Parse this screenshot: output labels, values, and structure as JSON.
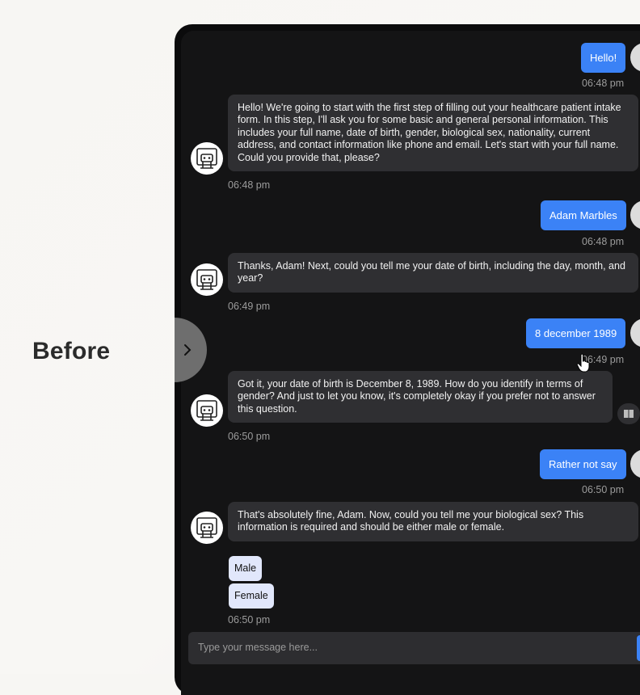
{
  "label": "Before",
  "messages": [
    {
      "role": "user",
      "text": "Hello!",
      "time": "06:48 pm"
    },
    {
      "role": "bot",
      "text": "Hello! We're going to start with the first step of filling out your healthcare patient intake form. In this step, I'll ask you for some basic and general personal information. This includes your full name, date of birth, gender, biological sex, nationality, current address, and contact information like phone and email. Let's start with your full name. Could you provide that, please?",
      "time": "06:48 pm"
    },
    {
      "role": "user",
      "text": "Adam Marbles",
      "time": "06:48 pm"
    },
    {
      "role": "bot",
      "text": "Thanks, Adam! Next, could you tell me your date of birth, including the day, month, and year?",
      "time": "06:49 pm"
    },
    {
      "role": "user",
      "text": "8 december 1989",
      "time": "06:49 pm"
    },
    {
      "role": "bot",
      "text": "Got it, your date of birth is December 8, 1989. How do you identify in terms of gender? And just to let you know, it's completely okay if you prefer not to answer this question.",
      "time": "06:50 pm"
    },
    {
      "role": "user",
      "text": "Rather not say",
      "time": "06:50 pm"
    },
    {
      "role": "bot",
      "text": "That's absolutely fine, Adam. Now, could you tell me your biological sex? This information is required and should be either male or female.",
      "time": "06:50 pm"
    }
  ],
  "options": [
    "Male",
    "Female"
  ],
  "input": {
    "placeholder": "Type your message here..."
  },
  "icons": {
    "bot_avatar": "robot-icon",
    "scroll": "chevron-right-icon",
    "read_aloud": "book-icon"
  },
  "colors": {
    "user_bubble": "#3b82f6",
    "bot_bubble": "#2f2f32",
    "background": "#141415",
    "option": "#e1e7fb"
  }
}
